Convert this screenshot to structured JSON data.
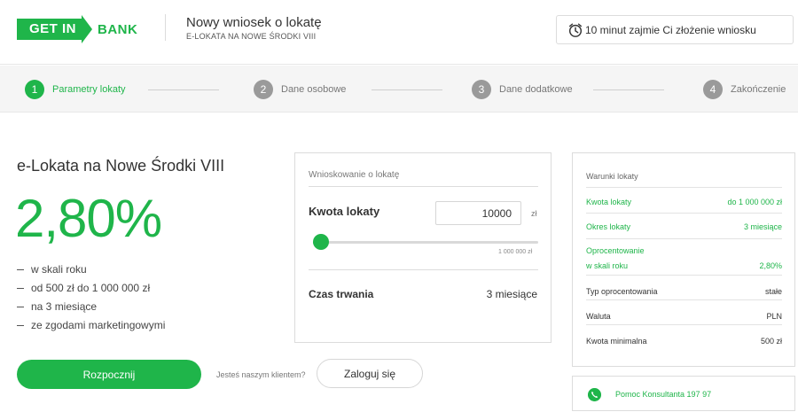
{
  "brand": {
    "logo_part1": "GET IN",
    "logo_part2": "BANK",
    "accent_color": "#1fb54a"
  },
  "header": {
    "title": "Nowy wniosek o lokatę",
    "subtitle": "E-LOKATA NA NOWE ŚRODKI VIII",
    "time_notice": "10 minut zajmie Ci złożenie wniosku",
    "time_icon": "alarm-clock-icon"
  },
  "steps": [
    {
      "number": "1",
      "label": "Parametry lokaty",
      "active": true
    },
    {
      "number": "2",
      "label": "Dane osobowe",
      "active": false
    },
    {
      "number": "3",
      "label": "Dane dodatkowe",
      "active": false
    },
    {
      "number": "4",
      "label": "Zakończenie",
      "active": false
    }
  ],
  "product": {
    "title": "e-Lokata na Nowe Środki VIII",
    "rate": "2,80%",
    "features": [
      "w skali roku",
      "od 500 zł do 1 000 000 zł",
      "na 3 miesiące",
      "ze zgodami marketingowymi"
    ]
  },
  "actions": {
    "start_label": "Rozpocznij",
    "client_question": "Jesteś naszym klientem?",
    "login_label": "Zaloguj się"
  },
  "calculator": {
    "heading": "Wnioskowanie o lokatę",
    "amount_label": "Kwota lokaty",
    "amount_value": "10000",
    "amount_unit": "zł",
    "slider_fraction": 0.0095,
    "slider_max_label": "1 000 000 zł",
    "duration_label": "Czas trwania",
    "duration_value": "3 miesiące"
  },
  "terms": {
    "heading": "Warunki lokaty",
    "rows": [
      {
        "key": "Kwota lokaty",
        "value": "do 1 000 000 zł",
        "highlight": true
      },
      {
        "key": "Okres lokaty",
        "value": "3 miesiące",
        "highlight": true
      },
      {
        "key": "Oprocentowanie",
        "key2": "w skali roku",
        "value": "2,80%",
        "highlight": true
      },
      {
        "key": "Typ oprocentowania",
        "value": "stałe",
        "highlight": false
      },
      {
        "key": "Waluta",
        "value": "PLN",
        "highlight": false
      },
      {
        "key": "Kwota minimalna",
        "value": "500 zł",
        "highlight": false
      }
    ]
  },
  "help": {
    "icon": "phone-icon",
    "text": "Pomoc Konsultanta 197 97"
  }
}
